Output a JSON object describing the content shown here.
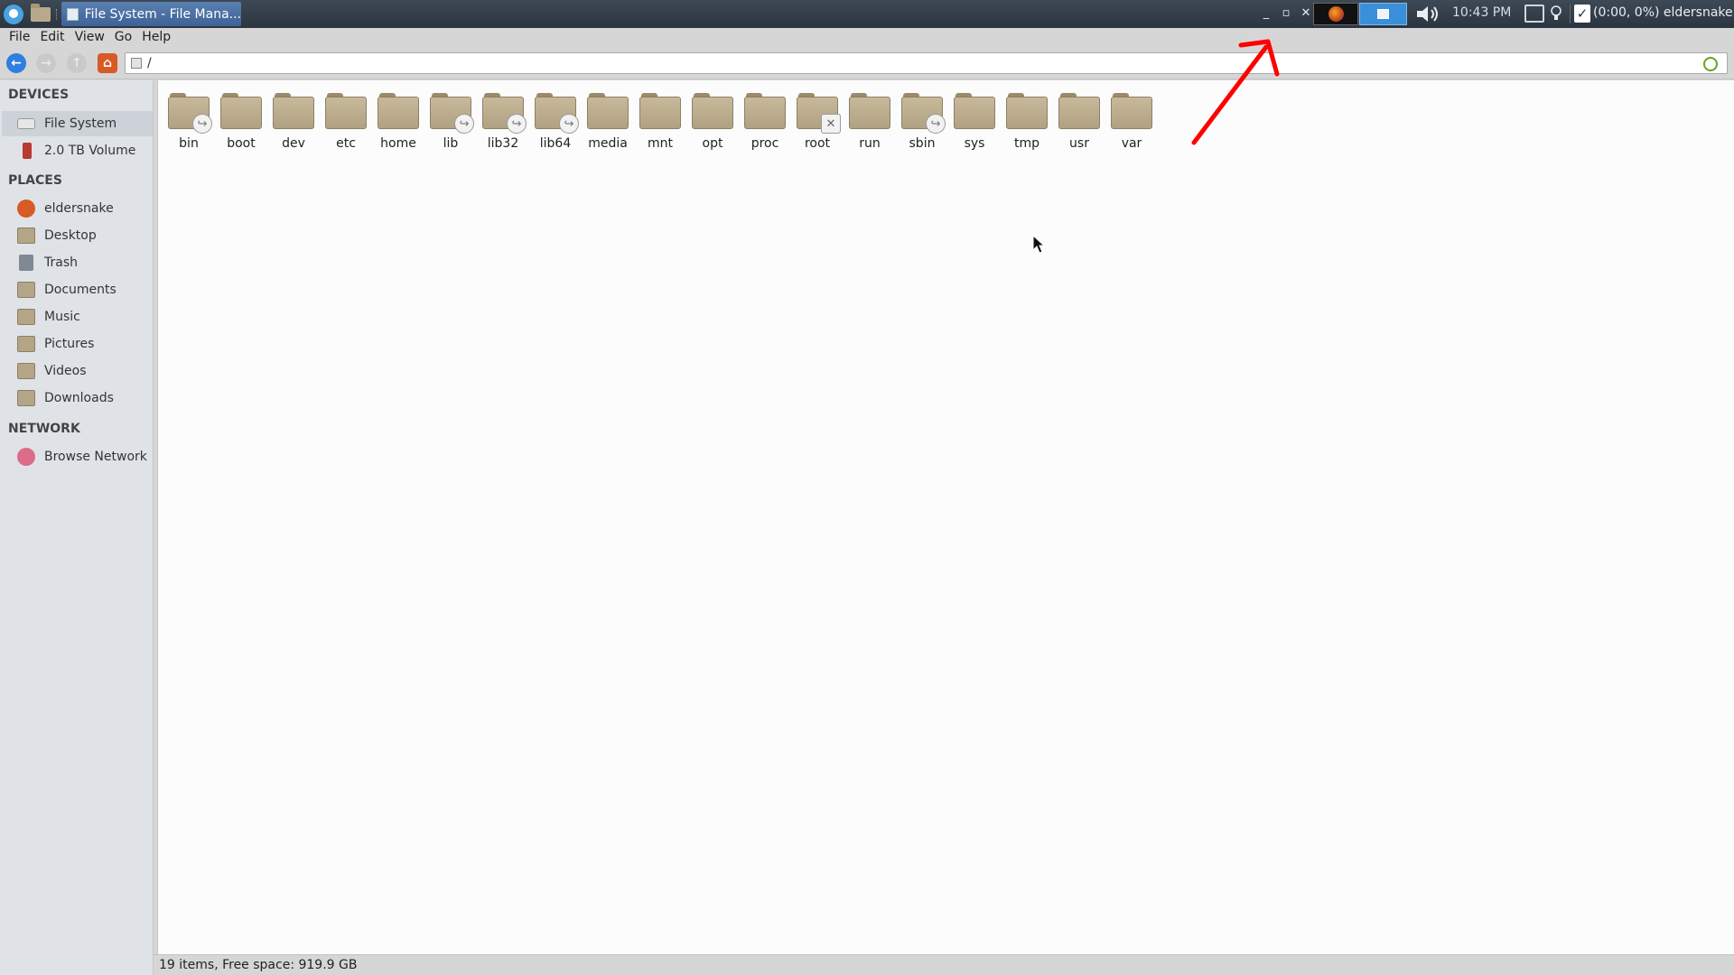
{
  "panel": {
    "window_title": "File System - File Mana...",
    "clock": "10:43 PM",
    "status": "(0:00, 0%) eldersnake",
    "window_controls": [
      "_",
      "▫",
      "✕"
    ]
  },
  "menubar": [
    "File",
    "Edit",
    "View",
    "Go",
    "Help"
  ],
  "toolbar": {
    "location": "/"
  },
  "sidebar": {
    "devices_header": "DEVICES",
    "devices": [
      {
        "label": "File System",
        "icon": "drive-icon"
      },
      {
        "label": "2.0 TB Volume",
        "icon": "usb-drive-icon"
      }
    ],
    "places_header": "PLACES",
    "places": [
      {
        "label": "eldersnake",
        "icon": "home-icon"
      },
      {
        "label": "Desktop",
        "icon": "folder-icon"
      },
      {
        "label": "Trash",
        "icon": "trash-icon"
      },
      {
        "label": "Documents",
        "icon": "folder-icon"
      },
      {
        "label": "Music",
        "icon": "folder-icon"
      },
      {
        "label": "Pictures",
        "icon": "folder-icon"
      },
      {
        "label": "Videos",
        "icon": "folder-icon"
      },
      {
        "label": "Downloads",
        "icon": "folder-icon"
      }
    ],
    "network_header": "NETWORK",
    "network": [
      {
        "label": "Browse Network",
        "icon": "network-icon"
      }
    ]
  },
  "files": [
    {
      "name": "bin",
      "emblem": "link"
    },
    {
      "name": "boot",
      "emblem": ""
    },
    {
      "name": "dev",
      "emblem": ""
    },
    {
      "name": "etc",
      "emblem": ""
    },
    {
      "name": "home",
      "emblem": ""
    },
    {
      "name": "lib",
      "emblem": "link"
    },
    {
      "name": "lib32",
      "emblem": "link"
    },
    {
      "name": "lib64",
      "emblem": "link"
    },
    {
      "name": "media",
      "emblem": ""
    },
    {
      "name": "mnt",
      "emblem": ""
    },
    {
      "name": "opt",
      "emblem": ""
    },
    {
      "name": "proc",
      "emblem": ""
    },
    {
      "name": "root",
      "emblem": "unreadable"
    },
    {
      "name": "run",
      "emblem": ""
    },
    {
      "name": "sbin",
      "emblem": "link"
    },
    {
      "name": "sys",
      "emblem": ""
    },
    {
      "name": "tmp",
      "emblem": ""
    },
    {
      "name": "usr",
      "emblem": ""
    },
    {
      "name": "var",
      "emblem": ""
    }
  ],
  "statusbar": {
    "text": "19 items, Free space: 919.9 GB"
  },
  "colors": {
    "annotation_arrow": "#ff0000",
    "panel_bg": "#2b3540",
    "active_task": "#3e6296"
  }
}
